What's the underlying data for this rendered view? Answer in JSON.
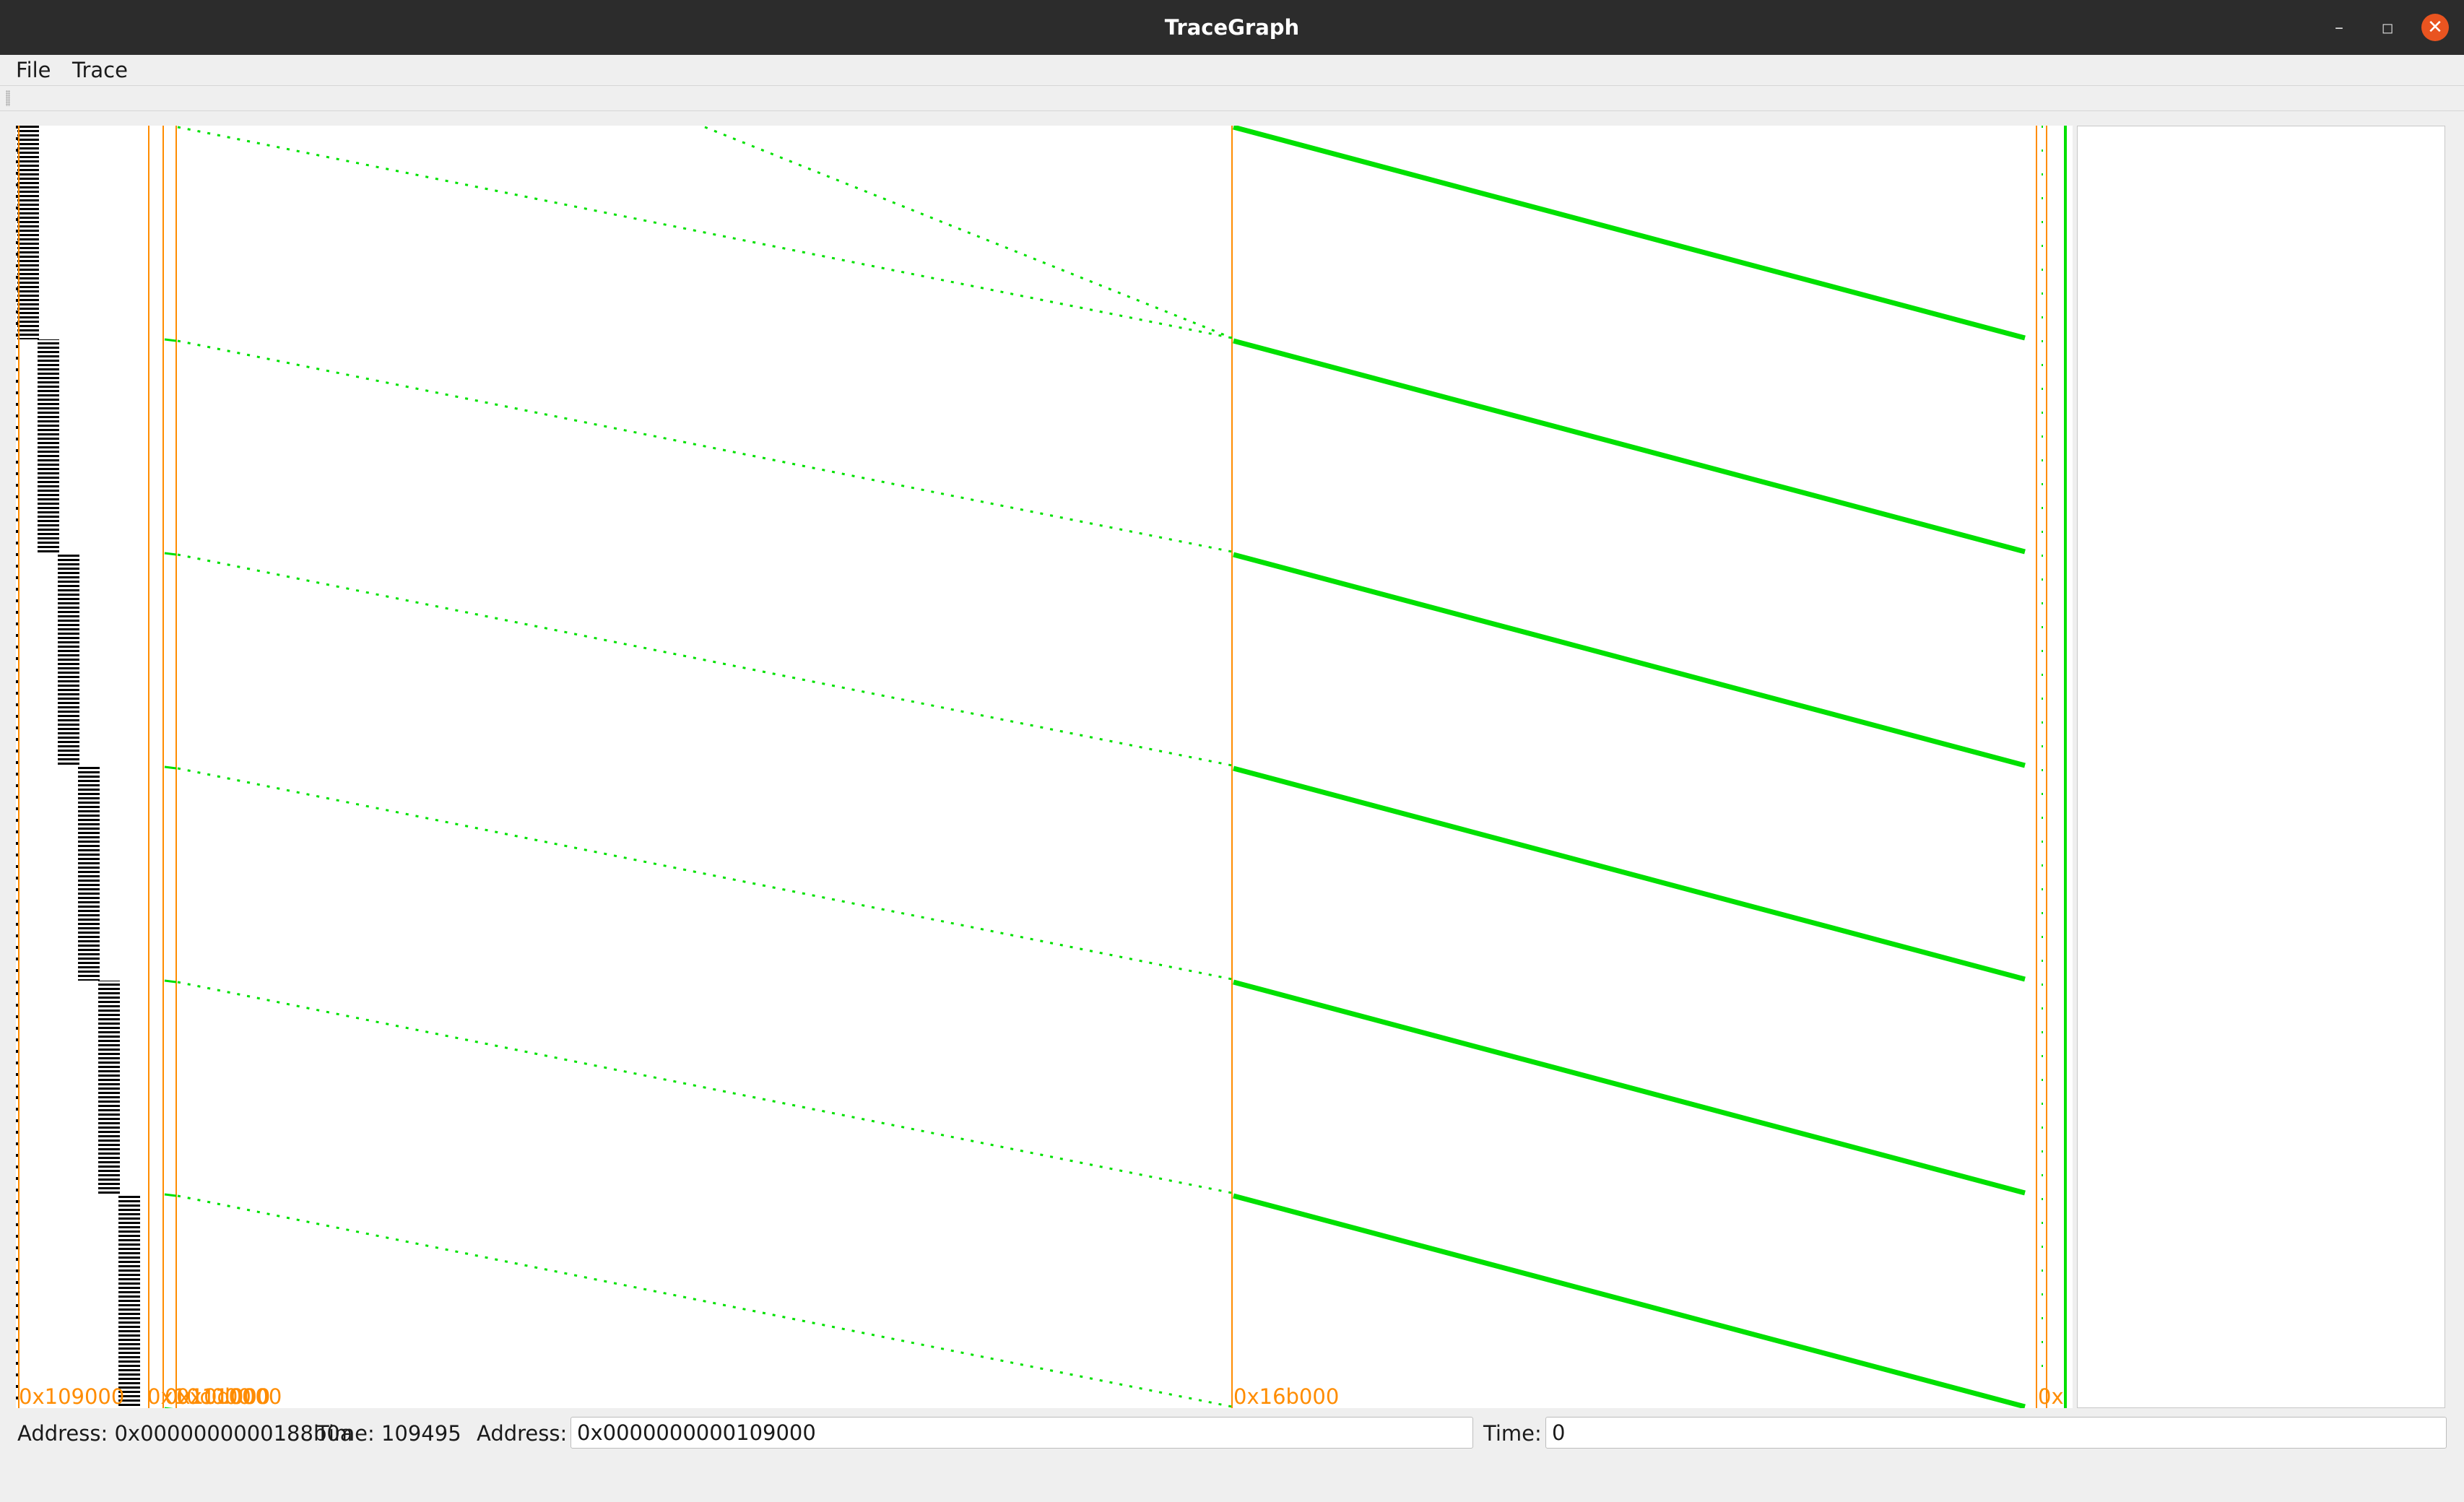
{
  "window": {
    "title": "TraceGraph",
    "controls": {
      "minimize": "–",
      "maximize": "◻",
      "close": "✕"
    }
  },
  "menubar": {
    "items": [
      "File",
      "Trace"
    ]
  },
  "plot": {
    "colors": {
      "region_marker": "#ff8c00",
      "trace_points": "#00e000",
      "early_trace": "#000000",
      "background": "#ffffff"
    },
    "region_labels": [
      "0x109000",
      "0x10c000",
      "0x10d000",
      "0x110000",
      "0x16b000",
      "0x"
    ]
  },
  "status": {
    "address_readout": "Address: 0x0000000000188b0a",
    "time_readout": "Time: 109495",
    "address_label": "Address:",
    "address_value": "0x0000000000109000",
    "time_label": "Time:",
    "time_value": "0"
  }
}
